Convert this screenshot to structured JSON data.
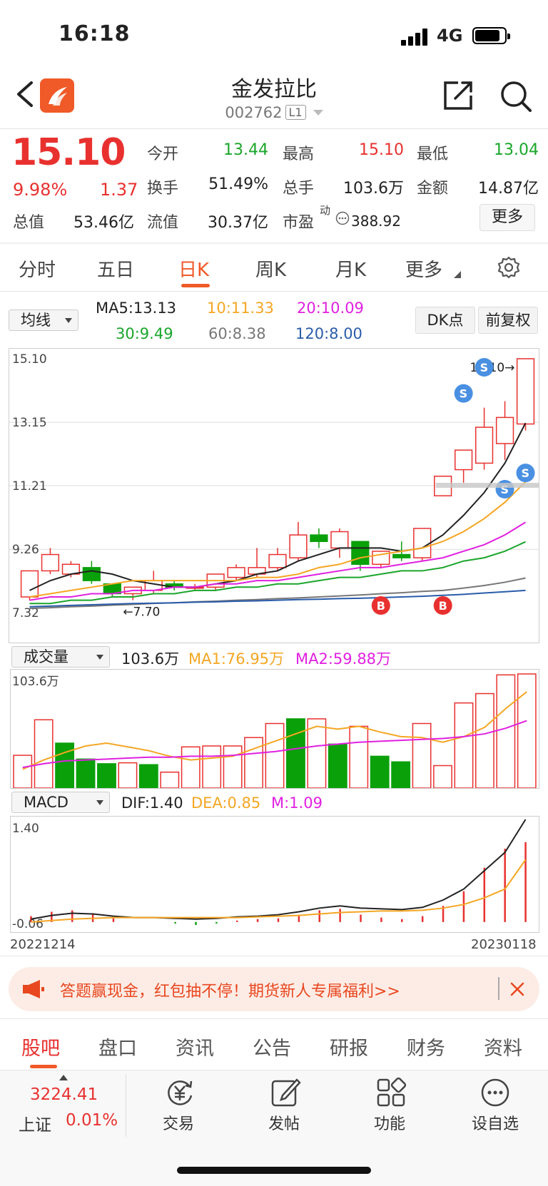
{
  "status": {
    "time": "16:18",
    "network": "4G"
  },
  "header": {
    "title": "金发拉比",
    "code": "002762",
    "level": "L1"
  },
  "quote": {
    "price": "15.10",
    "change_pct": "9.98%",
    "change": "1.37",
    "rows": [
      [
        {
          "label": "今开",
          "value": "13.44",
          "color": "green"
        },
        {
          "label": "最高",
          "value": "15.10",
          "color": "red"
        },
        {
          "label": "最低",
          "value": "13.04",
          "color": "green"
        }
      ],
      [
        {
          "label": "换手",
          "value": "51.49%",
          "color": "black"
        },
        {
          "label": "总手",
          "value": "103.6万",
          "color": "black"
        },
        {
          "label": "金额",
          "value": "14.87亿",
          "color": "black"
        }
      ]
    ],
    "total_value_label": "总值",
    "total_value": "53.46亿",
    "float_label": "流值",
    "float_value": "30.37亿",
    "pe_label": "市盈",
    "pe_super": "动",
    "pe_value": "388.92",
    "more_label": "更多"
  },
  "tabs": [
    "分时",
    "五日",
    "日K",
    "周K",
    "月K",
    "更多"
  ],
  "active_tab": "日K",
  "ma_bar": {
    "select_label": "均线",
    "ma5": "MA5:13.13",
    "ma10": "10:11.33",
    "ma20": "20:10.09",
    "ma30": "30:9.49",
    "ma60": "60:8.38",
    "ma120": "120:8.00",
    "dk_label": "DK点",
    "adj_label": "前复权"
  },
  "colors": {
    "up": "#e8312f",
    "down": "#0aa00a",
    "ma5": "#222222",
    "ma10": "#f5a623",
    "ma20": "#e020e0",
    "ma30": "#1aa62a",
    "ma60": "#777777",
    "ma120": "#2a5caa",
    "accent": "#f05a28"
  },
  "chart_data": [
    {
      "type": "candlestick",
      "y_labels": [
        "15.10",
        "13.15",
        "11.21",
        "9.26",
        "7.32"
      ],
      "ylim": [
        7.32,
        15.1
      ],
      "high_marker": "15.10",
      "low_marker": "7.70",
      "signals": [
        "S",
        "S",
        "S",
        "S",
        "B",
        "B"
      ],
      "candles": [
        {
          "o": 7.8,
          "c": 8.6,
          "h": 8.6,
          "l": 7.7
        },
        {
          "o": 8.6,
          "c": 9.1,
          "h": 9.3,
          "l": 8.5
        },
        {
          "o": 8.5,
          "c": 8.8,
          "h": 8.9,
          "l": 8.4
        },
        {
          "o": 8.7,
          "c": 8.3,
          "h": 8.9,
          "l": 8.2
        },
        {
          "o": 8.2,
          "c": 7.9,
          "h": 8.2,
          "l": 7.8
        },
        {
          "o": 7.9,
          "c": 8.1,
          "h": 8.1,
          "l": 7.7
        },
        {
          "o": 8.0,
          "c": 8.3,
          "h": 8.6,
          "l": 7.9
        },
        {
          "o": 8.2,
          "c": 8.1,
          "h": 8.3,
          "l": 8.0
        },
        {
          "o": 8.1,
          "c": 8.1,
          "h": 8.2,
          "l": 8.0
        },
        {
          "o": 8.1,
          "c": 8.5,
          "h": 8.5,
          "l": 8.0
        },
        {
          "o": 8.4,
          "c": 8.7,
          "h": 8.8,
          "l": 8.3
        },
        {
          "o": 8.5,
          "c": 8.7,
          "h": 9.3,
          "l": 8.4
        },
        {
          "o": 8.7,
          "c": 9.1,
          "h": 9.3,
          "l": 8.6
        },
        {
          "o": 9.0,
          "c": 9.7,
          "h": 10.1,
          "l": 8.9
        },
        {
          "o": 9.7,
          "c": 9.5,
          "h": 9.9,
          "l": 9.3
        },
        {
          "o": 9.3,
          "c": 9.8,
          "h": 9.9,
          "l": 9.0
        },
        {
          "o": 9.5,
          "c": 8.8,
          "h": 9.5,
          "l": 8.6
        },
        {
          "o": 8.8,
          "c": 9.2,
          "h": 9.2,
          "l": 8.7
        },
        {
          "o": 9.1,
          "c": 9.0,
          "h": 9.5,
          "l": 8.9
        },
        {
          "o": 9.0,
          "c": 9.9,
          "h": 9.9,
          "l": 8.9
        },
        {
          "o": 10.9,
          "c": 11.5,
          "h": 11.5,
          "l": 10.9
        },
        {
          "o": 11.7,
          "c": 12.3,
          "h": 12.3,
          "l": 11.3
        },
        {
          "o": 11.9,
          "c": 13.0,
          "h": 13.6,
          "l": 11.7
        },
        {
          "o": 12.5,
          "c": 13.3,
          "h": 13.8,
          "l": 12.0
        },
        {
          "o": 13.1,
          "c": 15.1,
          "h": 15.1,
          "l": 12.9
        }
      ],
      "ma5": [
        8.0,
        8.3,
        8.5,
        8.6,
        8.5,
        8.3,
        8.2,
        8.1,
        8.1,
        8.2,
        8.3,
        8.5,
        8.6,
        8.9,
        9.1,
        9.3,
        9.3,
        9.3,
        9.2,
        9.3,
        9.7,
        10.3,
        11.0,
        11.9,
        13.13
      ],
      "ma10": [
        7.8,
        7.9,
        8.0,
        8.1,
        8.2,
        8.3,
        8.3,
        8.3,
        8.3,
        8.3,
        8.3,
        8.4,
        8.4,
        8.5,
        8.7,
        8.8,
        9.0,
        9.1,
        9.2,
        9.3,
        9.5,
        9.8,
        10.2,
        10.7,
        11.33
      ],
      "ma20": [
        7.7,
        7.8,
        7.8,
        7.9,
        7.9,
        8.0,
        8.0,
        8.1,
        8.1,
        8.2,
        8.2,
        8.3,
        8.3,
        8.4,
        8.5,
        8.6,
        8.7,
        8.7,
        8.8,
        8.9,
        9.0,
        9.2,
        9.4,
        9.7,
        10.09
      ],
      "ma30": [
        7.6,
        7.6,
        7.7,
        7.7,
        7.8,
        7.8,
        7.9,
        7.9,
        8.0,
        8.0,
        8.1,
        8.1,
        8.2,
        8.2,
        8.3,
        8.4,
        8.4,
        8.5,
        8.6,
        8.6,
        8.7,
        8.9,
        9.0,
        9.2,
        9.49
      ],
      "ma60": [
        7.45,
        7.47,
        7.5,
        7.52,
        7.55,
        7.57,
        7.6,
        7.62,
        7.65,
        7.67,
        7.7,
        7.72,
        7.75,
        7.77,
        7.8,
        7.83,
        7.86,
        7.9,
        7.93,
        7.97,
        8.0,
        8.07,
        8.15,
        8.25,
        8.38
      ],
      "ma120": [
        7.5,
        7.52,
        7.54,
        7.56,
        7.58,
        7.6,
        7.61,
        7.62,
        7.64,
        7.65,
        7.67,
        7.68,
        7.7,
        7.72,
        7.73,
        7.75,
        7.76,
        7.78,
        7.8,
        7.82,
        7.85,
        7.88,
        7.92,
        7.96,
        8.0
      ]
    },
    {
      "type": "bar",
      "select_label": "成交量",
      "value_label": "103.6万",
      "ma1_label": "MA1:76.95万",
      "ma2_label": "MA2:59.88万",
      "ylabel_max": "103.6万",
      "ylim": [
        0,
        103.6
      ],
      "values": [
        35,
        73,
        48,
        31,
        26,
        27,
        25,
        17,
        44,
        45,
        45,
        54,
        69,
        74,
        74,
        47,
        66,
        34,
        28,
        69,
        24,
        91,
        101,
        121,
        122
      ],
      "up": [
        true,
        true,
        false,
        false,
        false,
        true,
        false,
        true,
        true,
        true,
        true,
        true,
        true,
        false,
        true,
        false,
        true,
        false,
        false,
        true,
        true,
        true,
        true,
        true,
        true
      ],
      "ma1": [
        20,
        30,
        38,
        45,
        48,
        44,
        40,
        34,
        30,
        32,
        34,
        42,
        50,
        58,
        66,
        63,
        66,
        60,
        55,
        54,
        49,
        55,
        65,
        85,
        103
      ],
      "ma2": [
        22,
        26,
        29,
        30,
        31,
        32,
        33,
        33,
        34,
        34,
        35,
        37,
        39,
        42,
        45,
        47,
        49,
        50,
        51,
        52,
        53,
        55,
        58,
        64,
        72
      ]
    },
    {
      "type": "macd",
      "select_label": "MACD",
      "dif_label": "DIF:1.40",
      "dea_label": "DEA:0.85",
      "m_label": "M:1.09",
      "y_labels": [
        "1.40",
        "-0.06"
      ],
      "ylim": [
        -0.06,
        1.4
      ],
      "dif": [
        0.04,
        0.09,
        0.12,
        0.11,
        0.08,
        0.06,
        0.06,
        0.05,
        0.04,
        0.05,
        0.07,
        0.08,
        0.1,
        0.14,
        0.19,
        0.22,
        0.19,
        0.18,
        0.17,
        0.2,
        0.3,
        0.45,
        0.7,
        0.95,
        1.4
      ],
      "dea": [
        0.0,
        0.02,
        0.04,
        0.05,
        0.06,
        0.06,
        0.06,
        0.06,
        0.06,
        0.06,
        0.06,
        0.07,
        0.08,
        0.09,
        0.11,
        0.13,
        0.14,
        0.15,
        0.15,
        0.16,
        0.19,
        0.24,
        0.33,
        0.45,
        0.85
      ],
      "m": [
        0.08,
        0.14,
        0.16,
        0.12,
        0.05,
        0.0,
        0.0,
        -0.02,
        -0.04,
        -0.02,
        0.02,
        0.04,
        0.05,
        0.1,
        0.16,
        0.18,
        0.1,
        0.06,
        0.04,
        0.08,
        0.22,
        0.42,
        0.74,
        1.0,
        1.09
      ],
      "x_start": "20221214",
      "x_end": "20230118"
    }
  ],
  "banner": {
    "text": "答题赢现金，红包抽不停！期货新人专属福利>>"
  },
  "bottom_tabs": [
    "股吧",
    "盘口",
    "资讯",
    "公告",
    "研报",
    "财务",
    "资料"
  ],
  "index": {
    "value": "3224.41",
    "name": "上证",
    "change": "0.01%"
  },
  "toolbar": [
    "交易",
    "发帖",
    "功能",
    "设自选"
  ]
}
